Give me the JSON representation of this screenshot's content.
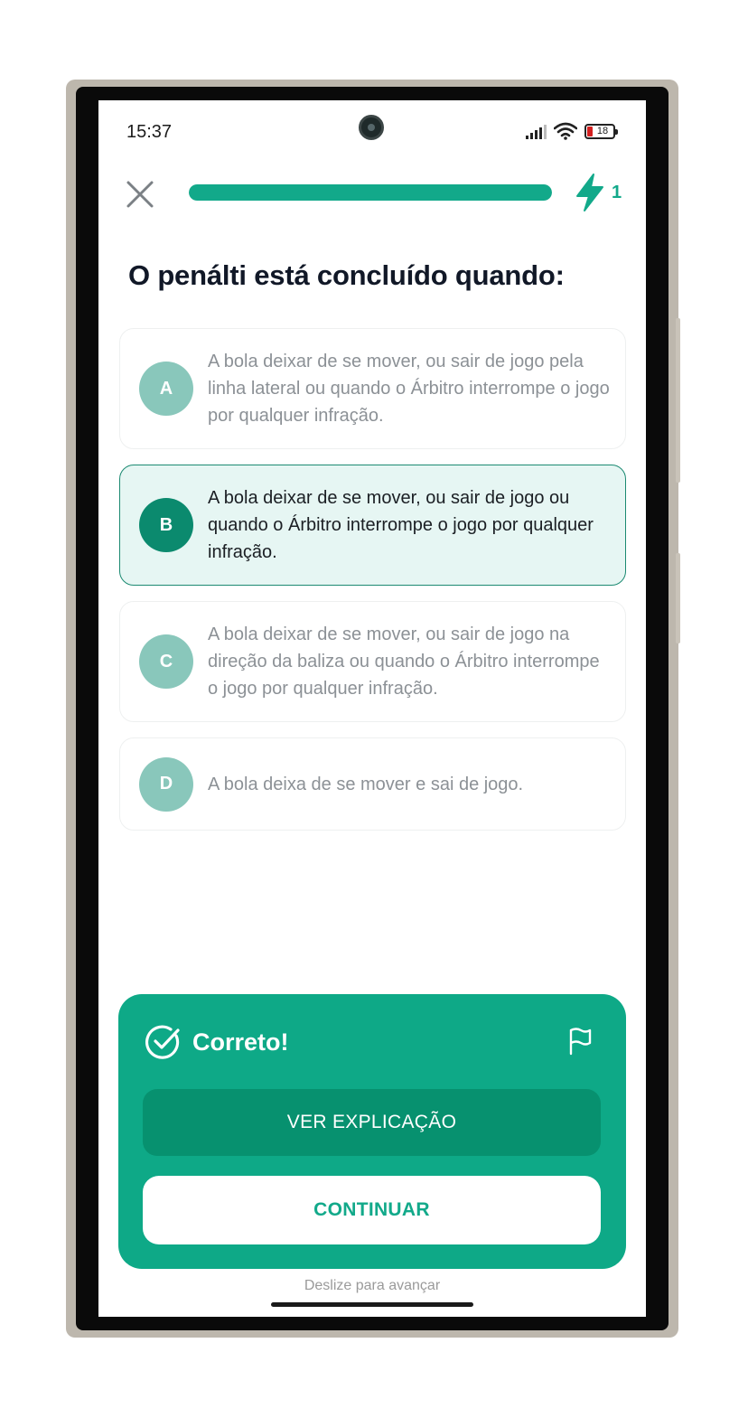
{
  "status_bar": {
    "time": "15:37",
    "battery": "18",
    "icons": [
      "signal-icon",
      "wifi-icon",
      "battery-icon"
    ]
  },
  "top_bar": {
    "close_icon": "close-icon",
    "progress_percent": 100,
    "streak_icon": "lightning-icon",
    "streak_count": "1"
  },
  "question": "O penálti está concluído quando:",
  "options": [
    {
      "letter": "A",
      "text": "A bola deixar de se mover, ou sair de jogo pela linha lateral ou quando o Árbitro interrompe o jogo por qualquer infração.",
      "selected": false
    },
    {
      "letter": "B",
      "text": "A bola deixar de se mover, ou sair de jogo ou quando o Árbitro interrompe o jogo por qualquer infração.",
      "selected": true
    },
    {
      "letter": "C",
      "text": "A bola deixar de se mover, ou sair de jogo na direção da baliza ou quando o Árbitro interrompe o jogo por qualquer infração.",
      "selected": false
    },
    {
      "letter": "D",
      "text": "A bola deixa de se mover e sai de jogo.",
      "selected": false
    }
  ],
  "feedback": {
    "icon": "check-circle-icon",
    "title": "Correto!",
    "flag_icon": "flag-icon",
    "explain_label": "VER EXPLICAÇÃO",
    "continue_label": "CONTINUAR"
  },
  "swipe_hint": "Deslize para avançar",
  "colors": {
    "accent": "#12a98a",
    "panel": "#0ea987",
    "selected_bg": "#e6f6f3"
  }
}
